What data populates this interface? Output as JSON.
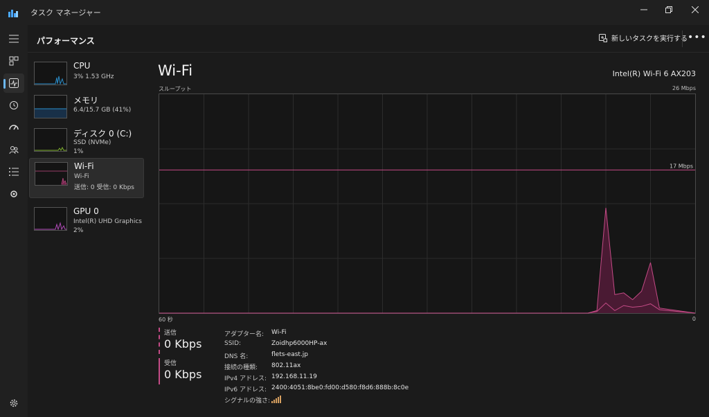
{
  "window": {
    "title": "タスク マネージャー"
  },
  "header": {
    "page_title": "パフォーマンス",
    "run_task_label": "新しいタスクを実行する",
    "more_label": "•••"
  },
  "perf_items": [
    {
      "name": "CPU",
      "line1": "3%  1.53 GHz",
      "line2": ""
    },
    {
      "name": "メモリ",
      "line1": "6.4/15.7 GB (41%)",
      "line2": ""
    },
    {
      "name": "ディスク 0 (C:)",
      "line1": "SSD (NVMe)",
      "line2": "1%"
    },
    {
      "name": "Wi-Fi",
      "line1": "Wi-Fi",
      "line2": "送信: 0  受信: 0 Kbps"
    },
    {
      "name": "GPU 0",
      "line1": "Intel(R) UHD Graphics",
      "line2": "2%"
    }
  ],
  "detail": {
    "title": "Wi-Fi",
    "adapter_model": "Intel(R) Wi-Fi 6 AX203",
    "throughput_label": "スループット",
    "max_label": "26 Mbps",
    "ref_label": "17 Mbps",
    "x_left": "60 秒",
    "x_right": "0"
  },
  "chart_data": {
    "type": "area",
    "xlabel": "60 秒",
    "ylabel": "スループット",
    "xlim": [
      60,
      0
    ],
    "ylim": [
      0,
      26
    ],
    "reference_line": 17,
    "series": [
      {
        "x": [
          60,
          12,
          11,
          10,
          9,
          8,
          7,
          6,
          5,
          4,
          0
        ],
        "values": [
          0,
          0,
          0.3,
          12.5,
          2.2,
          2.4,
          1.6,
          2.6,
          6.0,
          0.6,
          0
        ]
      },
      {
        "x": [
          60,
          12,
          11,
          10,
          9,
          8,
          7,
          6,
          5,
          4,
          0
        ],
        "values": [
          0,
          0,
          0.2,
          1.2,
          0.3,
          0.9,
          0.7,
          0.8,
          1.1,
          0.4,
          0
        ]
      }
    ]
  },
  "stats": {
    "send_label": "送信",
    "send_value": "0 Kbps",
    "recv_label": "受信",
    "recv_value": "0 Kbps"
  },
  "properties": [
    {
      "key": "アダプター名:",
      "value": "Wi-Fi"
    },
    {
      "key": "SSID:",
      "value": "Zoidhp6000HP-ax"
    },
    {
      "key": "DNS 名:",
      "value": "flets-east.jp"
    },
    {
      "key": "接続の種類:",
      "value": "802.11ax"
    },
    {
      "key": "IPv4 アドレス:",
      "value": "192.168.11.19"
    },
    {
      "key": "IPv6 アドレス:",
      "value": "2400:4051:8be0:fd00:d580:f8d6:888b:8c0e"
    },
    {
      "key": "シグナルの強さ:",
      "value": ""
    }
  ],
  "colors": {
    "accent": "#6cb8f6",
    "wifi": "#c44b86",
    "cpu": "#2a8cc8",
    "disk": "#7fb02e",
    "gpu": "#b04ab8"
  }
}
